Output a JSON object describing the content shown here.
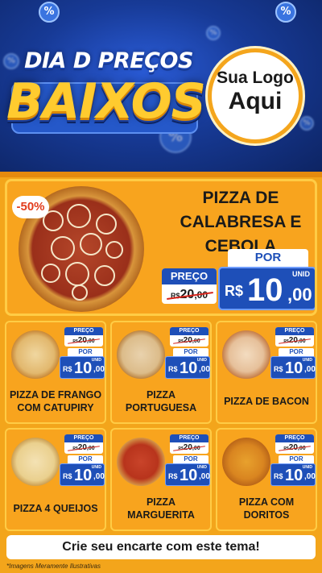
{
  "header": {
    "title_top": "DIA D PREÇOS",
    "title_main": "BAIXOS",
    "logo_line1": "Sua Logo",
    "logo_line2": "Aqui",
    "percent_symbol": "%"
  },
  "featured": {
    "discount": "-50%",
    "name": "PIZZA DE CALABRESA E CEBOLA",
    "preco_label": "PREÇO",
    "old_currency": "R$",
    "old_price": "20",
    "old_cents": ",00",
    "por_label": "POR",
    "unid_label": "UNID",
    "currency": "R$",
    "new_price": "10",
    "new_cents": ",00"
  },
  "items": [
    {
      "name": "PIZZA DE FRANGO COM CATUPIRY",
      "preco_label": "PREÇO",
      "old_currency": "R$",
      "old_price": "20",
      "old_cents": ",00",
      "por_label": "POR",
      "unid_label": "UNID",
      "currency": "R$",
      "new_price": "10",
      "new_cents": ",00"
    },
    {
      "name": "PIZZA PORTUGUESA",
      "preco_label": "PREÇO",
      "old_currency": "R$",
      "old_price": "20",
      "old_cents": ",00",
      "por_label": "POR",
      "unid_label": "UNID",
      "currency": "R$",
      "new_price": "10",
      "new_cents": ",00"
    },
    {
      "name": "PIZZA DE BACON",
      "preco_label": "PREÇO",
      "old_currency": "R$",
      "old_price": "20",
      "old_cents": ",00",
      "por_label": "POR",
      "unid_label": "UNID",
      "currency": "R$",
      "new_price": "10",
      "new_cents": ",00"
    },
    {
      "name": "PIZZA 4 QUEIJOS",
      "preco_label": "PREÇO",
      "old_currency": "R$",
      "old_price": "20",
      "old_cents": ",00",
      "por_label": "POR",
      "unid_label": "UNID",
      "currency": "R$",
      "new_price": "10",
      "new_cents": ",00"
    },
    {
      "name": "PIZZA MARGUERITA",
      "preco_label": "PREÇO",
      "old_currency": "R$",
      "old_price": "20",
      "old_cents": ",00",
      "por_label": "POR",
      "unid_label": "UNID",
      "currency": "R$",
      "new_price": "10",
      "new_cents": ",00"
    },
    {
      "name": "PIZZA COM DORITOS",
      "preco_label": "PREÇO",
      "old_currency": "R$",
      "old_price": "20",
      "old_cents": ",00",
      "por_label": "POR",
      "unid_label": "UNID",
      "currency": "R$",
      "new_price": "10",
      "new_cents": ",00"
    }
  ],
  "cta": "Crie seu encarte com este tema!",
  "footnote": "*Imagens Meramente Ilustrativas",
  "colors": {
    "header_blue": "#173a96",
    "accent_yellow": "#ffcb2f",
    "card_orange": "#f8a41e",
    "price_blue": "#1e4fb8",
    "strike_red": "#d6241b"
  }
}
